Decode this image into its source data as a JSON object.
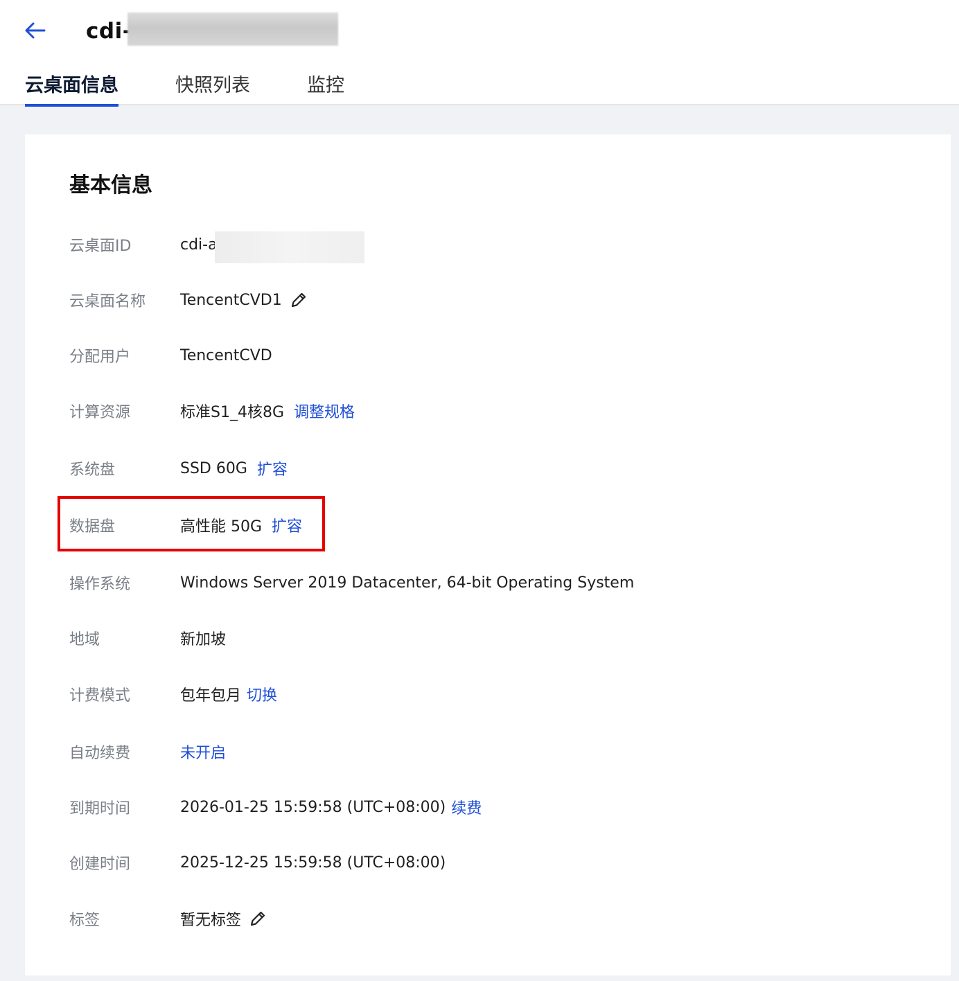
{
  "header": {
    "title": "cdi-",
    "back_icon": "arrow-left-icon",
    "accent_color": "#1f4fd8"
  },
  "tabs": [
    {
      "label": "云桌面信息",
      "active": true
    },
    {
      "label": "快照列表",
      "active": false
    },
    {
      "label": "监控",
      "active": false
    }
  ],
  "basic_info": {
    "title": "基本信息",
    "desktop_id": {
      "label": "云桌面ID",
      "value": "cdi-a"
    },
    "desktop_name": {
      "label": "云桌面名称",
      "value": "TencentCVD1",
      "icon": "pencil-icon"
    },
    "assigned_user": {
      "label": "分配用户",
      "value": "TencentCVD"
    },
    "compute": {
      "label": "计算资源",
      "value": "标准S1_4核8G",
      "action": "调整规格"
    },
    "system_disk": {
      "label": "系统盘",
      "value": "SSD 60G",
      "action": "扩容"
    },
    "data_disk": {
      "label": "数据盘",
      "value": "高性能 50G",
      "action": "扩容",
      "highlight_color": "#e60000"
    },
    "os": {
      "label": "操作系统",
      "value": "Windows Server 2019 Datacenter, 64-bit Operating System"
    },
    "region": {
      "label": "地域",
      "value": "新加坡"
    },
    "billing": {
      "label": "计费模式",
      "value": "包年包月",
      "action": "切换"
    },
    "auto_renew": {
      "label": "自动续费",
      "action": "未开启"
    },
    "expire_time": {
      "label": "到期时间",
      "value": "2026-01-25 15:59:58 (UTC+08:00)",
      "action": "续费"
    },
    "create_time": {
      "label": "创建时间",
      "value": "2025-12-25 15:59:58 (UTC+08:00)"
    },
    "tags": {
      "label": "标签",
      "value": "暂无标签",
      "icon": "pencil-icon"
    }
  }
}
